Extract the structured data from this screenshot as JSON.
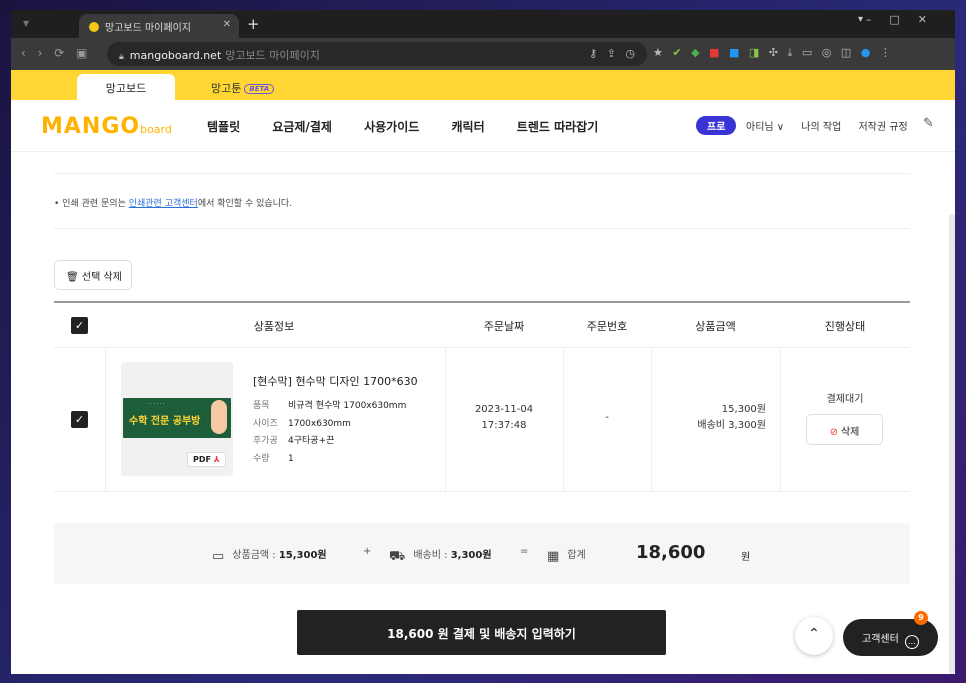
{
  "browser": {
    "tab_title": "망고보드 마이페이지",
    "url_domain": "mangoboard.net",
    "url_title": "망고보드 마이페이지"
  },
  "site_tabs": [
    {
      "label": "망고보드"
    },
    {
      "label": "망고툰",
      "badge": "BETA"
    }
  ],
  "header": {
    "logo": "MANGO",
    "logo_sub": "board",
    "nav": [
      "템플릿",
      "요금제/결제",
      "사용가이드",
      "캐릭터",
      "트렌드 따라잡기"
    ],
    "pro_badge": "프로",
    "user": "아티님 ∨",
    "links": [
      "나의 작업",
      "저작권 규정"
    ]
  },
  "notice": {
    "prefix": "• 인쇄 관련 문의는 ",
    "link": "인쇄관련 고객센터",
    "suffix": "에서 확인할 수 있습니다."
  },
  "delete_selected": "선택 삭제",
  "table": {
    "headers": [
      "상품정보",
      "주문날짜",
      "주문번호",
      "상품금액",
      "진행상태"
    ],
    "row": {
      "thumb_title": "수학 전문 공부방",
      "thumb_badge": "PDF",
      "name": "[현수막] 현수막 디자인 1700*630",
      "specs": [
        {
          "k": "품목",
          "v": "비규격 현수막 1700x630mm"
        },
        {
          "k": "사이즈",
          "v": "1700x630mm"
        },
        {
          "k": "후가공",
          "v": "4구타공+끈"
        },
        {
          "k": "수량",
          "v": "1"
        }
      ],
      "date": "2023-11-04",
      "time": "17:37:48",
      "order_no": "-",
      "price": "15,300원",
      "shipping": "배송비 3,300원",
      "status": "결제대기",
      "delete": "삭제"
    }
  },
  "summary": {
    "product_label": "상품금액 : ",
    "product_value": "15,300원",
    "plus": "+",
    "ship_label": "배송비 : ",
    "ship_value": "3,300원",
    "eq": "=",
    "total_label": "합계",
    "total": "18,600",
    "won": "원"
  },
  "pay_button": "18,600 원 결제 및 배송지 입력하기",
  "cs_button": "고객센터",
  "cs_badge": "9",
  "colors": {
    "brand_yellow": "#ffd633",
    "pro_blue": "#3a33d6",
    "dark": "#222222"
  }
}
